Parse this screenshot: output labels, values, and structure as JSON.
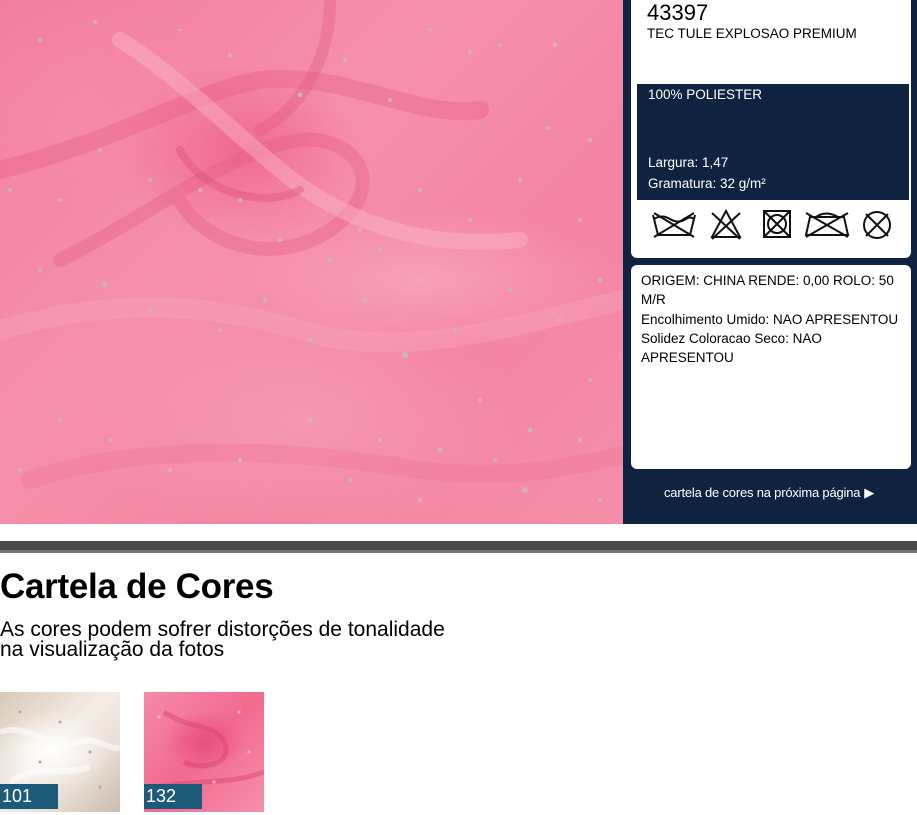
{
  "product": {
    "code": "43397",
    "name": "TEC TULE EXPLOSAO PREMIUM",
    "composition": "100% POLIESTER",
    "width": "Largura: 1,47",
    "weight": "Gramatura: 32 g/m²"
  },
  "care_icons": [
    "no-wash-icon",
    "no-bleach-icon",
    "no-tumble-dry-icon",
    "no-iron-icon",
    "no-dry-clean-icon"
  ],
  "notes": {
    "origin": "ORIGEM: CHINA RENDE: 0,00 ROLO: 50 M/R",
    "shrink": "Encolhimento Umido: NAO APRESENTOU",
    "color_fastness": "Solidez Coloracao Seco: NAO APRESENTOU"
  },
  "next_page": "cartela de cores na próxima página",
  "color_chart": {
    "title": "Cartela de Cores",
    "subtitle_line1": "As cores podem sofrer distorções de tonalidade",
    "subtitle_line2": "na visualização da fotos",
    "swatches": [
      {
        "code": "101",
        "color": "#efe6dc"
      },
      {
        "code": "132",
        "color": "#f27a9c"
      }
    ]
  },
  "colors": {
    "navy": "#0f2340",
    "swatch_label": "#1d5a7a"
  }
}
